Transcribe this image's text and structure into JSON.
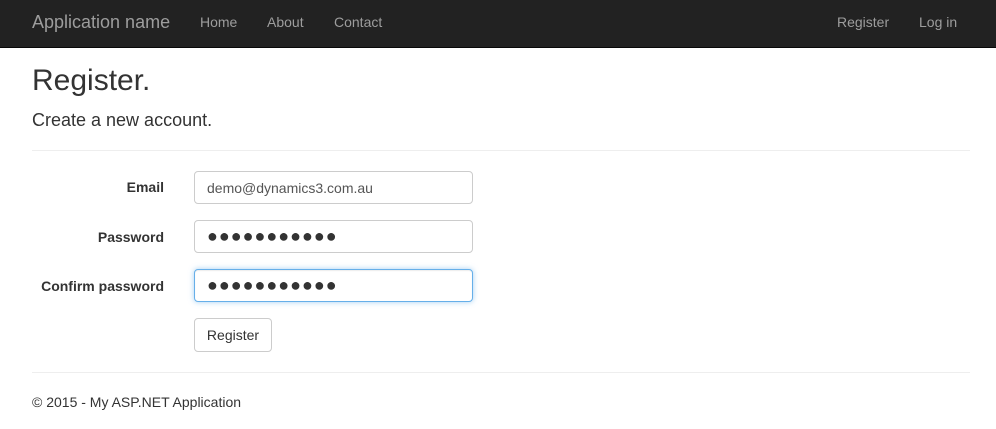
{
  "navbar": {
    "brand": "Application name",
    "links": [
      "Home",
      "About",
      "Contact"
    ],
    "right_links": [
      "Register",
      "Log in"
    ]
  },
  "page": {
    "title": "Register.",
    "subtitle": "Create a new account."
  },
  "form": {
    "email_label": "Email",
    "email_value": "demo@dynamics3.com.au",
    "password_label": "Password",
    "password_value": "●●●●●●●●●●●",
    "confirm_label": "Confirm password",
    "confirm_value": "●●●●●●●●●●●",
    "submit_label": "Register"
  },
  "footer": {
    "text": "© 2015 - My ASP.NET Application"
  }
}
